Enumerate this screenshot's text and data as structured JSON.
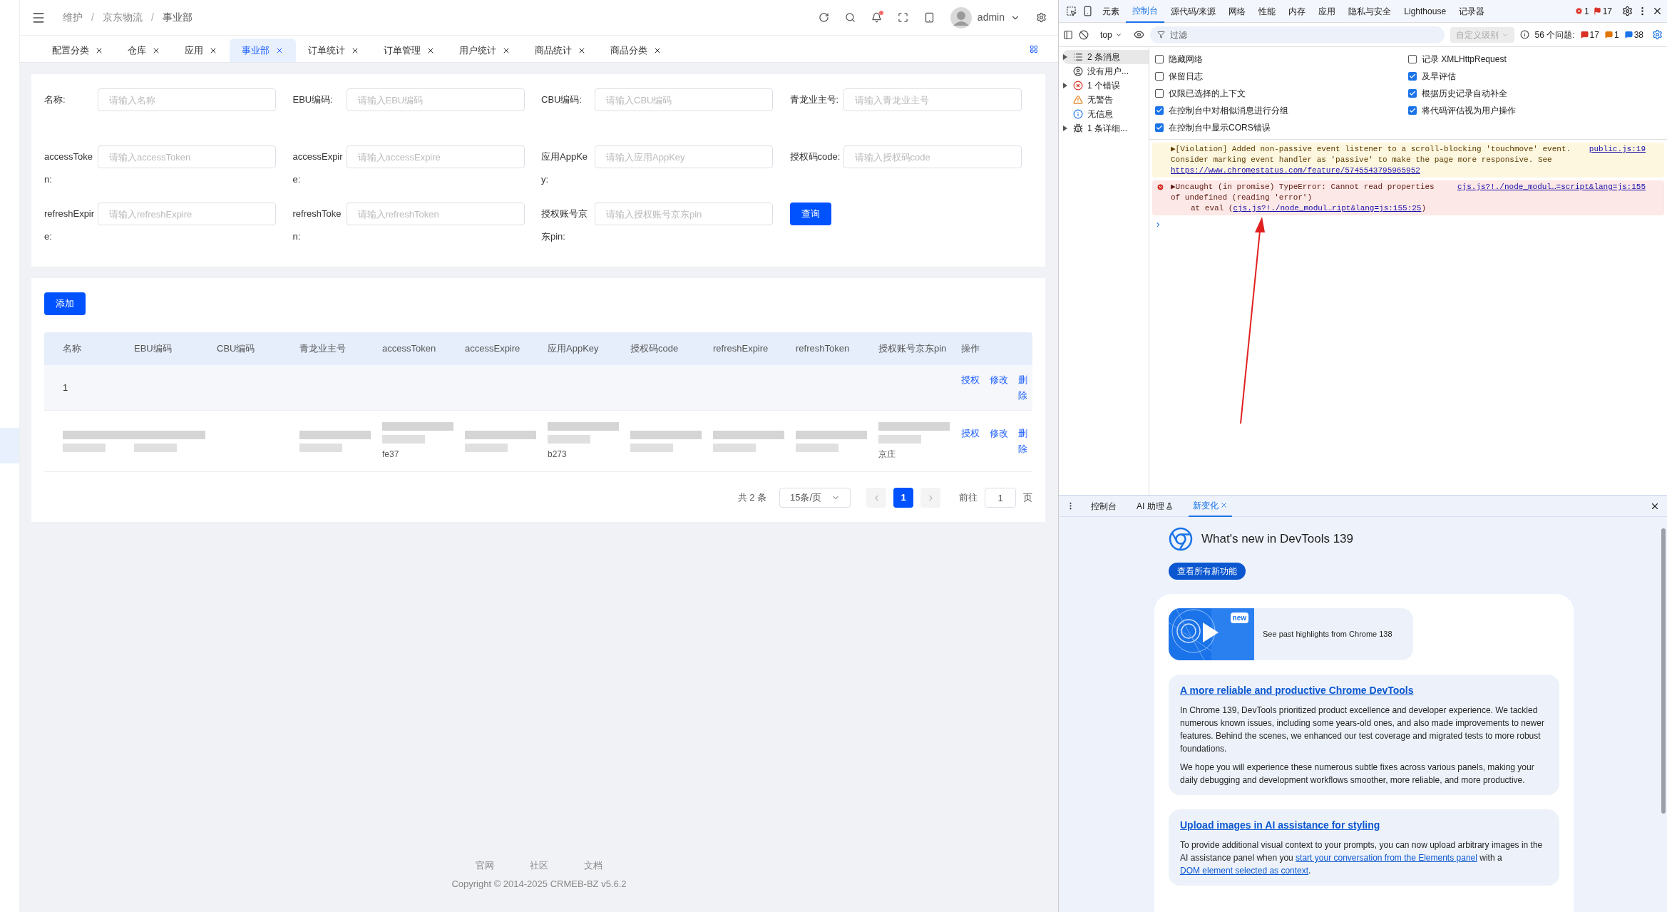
{
  "header": {
    "breadcrumb": [
      "维护",
      "京东物流",
      "事业部"
    ],
    "separator": "/",
    "user": "admin"
  },
  "tabs": [
    {
      "label": "配置分类",
      "selected": false
    },
    {
      "label": "仓库",
      "selected": false
    },
    {
      "label": "应用",
      "selected": false
    },
    {
      "label": "事业部",
      "selected": true
    },
    {
      "label": "订单统计",
      "selected": false
    },
    {
      "label": "订单管理",
      "selected": false
    },
    {
      "label": "用户统计",
      "selected": false
    },
    {
      "label": "商品统计",
      "selected": false
    },
    {
      "label": "商品分类",
      "selected": false
    }
  ],
  "filters": [
    {
      "label": "名称:",
      "placeholder": "请输入名称"
    },
    {
      "label": "EBU编码:",
      "placeholder": "请输入EBU编码"
    },
    {
      "label": "CBU编码:",
      "placeholder": "请输入CBU编码"
    },
    {
      "label": "青龙业主号:",
      "placeholder": "请输入青龙业主号"
    },
    {
      "label": "accessToken:",
      "placeholder": "请输入accessToken"
    },
    {
      "label": "accessExpire:",
      "placeholder": "请输入accessExpire"
    },
    {
      "label": "应用AppKey:",
      "placeholder": "请输入应用AppKey"
    },
    {
      "label": "授权码code:",
      "placeholder": "请输入授权码code"
    },
    {
      "label": "refreshExpire:",
      "placeholder": "请输入refreshExpire"
    },
    {
      "label": "refreshToken:",
      "placeholder": "请输入refreshToken"
    },
    {
      "label": "授权账号京东pin:",
      "placeholder": "请输入授权账号京东pin"
    }
  ],
  "query_button": "查询",
  "add_button": "添加",
  "table": {
    "columns": [
      "名称",
      "EBU编码",
      "CBU编码",
      "青龙业主号",
      "accessToken",
      "accessExpire",
      "应用AppKey",
      "授权码code",
      "refreshExpire",
      "refreshToken",
      "授权账号京东pin",
      "操作"
    ],
    "rows": [
      {
        "cells": [
          {
            "text": "1",
            "blurred": false
          },
          {
            "blurred": false
          },
          {
            "blurred": false
          },
          {
            "blurred": false
          },
          {
            "blurred": false
          },
          {
            "blurred": false
          },
          {
            "blurred": false
          },
          {
            "blurred": false
          },
          {
            "blurred": false
          },
          {
            "blurred": false
          },
          {
            "blurred": false
          }
        ],
        "actions": [
          "授权",
          "修改",
          "删除"
        ]
      },
      {
        "cells": [
          {
            "blurred": true
          },
          {
            "blurred": true
          },
          {
            "blurred": false
          },
          {
            "blurred": true
          },
          {
            "text": "fe37",
            "blurred": true
          },
          {
            "blurred": true
          },
          {
            "text": "b273",
            "blurred": true
          },
          {
            "blurred": true
          },
          {
            "blurred": true
          },
          {
            "blurred": true
          },
          {
            "text": "京庄",
            "blurred": true
          }
        ],
        "actions": [
          "授权",
          "修改",
          "删除"
        ]
      }
    ]
  },
  "pagination": {
    "total": "共 2 条",
    "page_size": "15条/页",
    "pages": [
      {
        "label": "1",
        "selected": true
      }
    ],
    "goto_label": "前往",
    "goto_value": "1",
    "page_unit": "页"
  },
  "footer": {
    "links": [
      "官网",
      "社区",
      "文档"
    ],
    "copyright": "Copyright © 2014-2025 CRMEB-BZ v5.6.2"
  },
  "devtools": {
    "tabs": [
      {
        "label": "元素",
        "selected": false
      },
      {
        "label": "控制台",
        "selected": true
      },
      {
        "label": "源代码/来源",
        "selected": false
      },
      {
        "label": "网络",
        "selected": false
      },
      {
        "label": "性能",
        "selected": false
      },
      {
        "label": "内存",
        "selected": false
      },
      {
        "label": "应用",
        "selected": false
      },
      {
        "label": "隐私与安全",
        "selected": false
      },
      {
        "label": "Lighthouse",
        "selected": false
      },
      {
        "label": "记录器",
        "selected": false
      }
    ],
    "error_count": "1",
    "issue_flag_count": "17",
    "context": "top",
    "filter_placeholder": "过滤",
    "level_dropdown": "自定义级别",
    "issues_label": "56 个问题:",
    "issue_counts": [
      {
        "kind": "error",
        "count": "17"
      },
      {
        "kind": "warning",
        "count": "1"
      },
      {
        "kind": "info",
        "count": "38"
      }
    ],
    "sidebar": [
      {
        "kind": "list",
        "label": "2 条消息",
        "selected": true,
        "expandable": true
      },
      {
        "kind": "user",
        "label": "没有用户...",
        "selected": false,
        "expandable": false
      },
      {
        "kind": "error",
        "label": "1 个错误",
        "selected": false,
        "expandable": true
      },
      {
        "kind": "warning",
        "label": "无警告",
        "selected": false,
        "expandable": false
      },
      {
        "kind": "info",
        "label": "无信息",
        "selected": false,
        "expandable": false
      },
      {
        "kind": "verbose",
        "label": "1 条详细...",
        "selected": false,
        "expandable": true
      }
    ],
    "settings": [
      [
        {
          "label": "隐藏网络",
          "checked": false
        },
        {
          "label": "保留日志",
          "checked": false
        },
        {
          "label": "仅限已选择的上下文",
          "checked": false
        },
        {
          "label": "在控制台中对相似消息进行分组",
          "checked": true
        },
        {
          "label": "在控制台中显示CORS错误",
          "checked": true
        }
      ],
      [
        {
          "label": "记录 XMLHttpRequest",
          "checked": false
        },
        {
          "label": "及早评估",
          "checked": true
        },
        {
          "label": "根据历史记录自动补全",
          "checked": true
        },
        {
          "label": "将代码评估视为用户操作",
          "checked": true
        }
      ]
    ],
    "messages": [
      {
        "kind": "warning",
        "text": "▶[Violation] Added non-passive event listener to a scroll-blocking 'touchmove' event. Consider marking event handler as 'passive' to make the page more responsive. See",
        "link": "https://www.chromestatus.com/feature/5745543795965952",
        "source": "public.js:19"
      },
      {
        "kind": "error",
        "text": "▶Uncaught (in promise) TypeError: Cannot read properties of undefined (reading 'error')",
        "trace_prefix": "at eval (",
        "trace_link": "cjs.js?!./node_modul…ript&lang=js:155:25",
        "trace_suffix": ")",
        "source": "cjs.js?!./node_modul…=script&lang=js:155"
      }
    ],
    "prompt": "›",
    "drawer_tabs": [
      {
        "label": "控制台",
        "selected": false,
        "closable": false
      },
      {
        "label": "AI 助理",
        "selected": false,
        "closable": false
      },
      {
        "label": "新变化",
        "selected": true,
        "closable": true
      }
    ],
    "whats_new": {
      "title": "What's new in DevTools 139",
      "button": "查看所有新功能",
      "video_badge": "new",
      "video_caption": "See past highlights from Chrome 138",
      "sections": [
        {
          "title": "A more reliable and productive Chrome DevTools",
          "paragraphs": [
            [
              {
                "text": "In Chrome 139, DevTools prioritized product excellence and developer experience. We tackled numerous known issues, including some years-old ones, and also made improvements to newer features. Behind the scenes, we enhanced our test coverage and migrated tests to more robust foundations."
              }
            ],
            [
              {
                "text": "We hope you will experience these numerous subtle fixes across various panels, making your daily debugging and development workflows smoother, more reliable, and more productive."
              }
            ]
          ]
        },
        {
          "title": "Upload images in AI assistance for styling",
          "paragraphs": [
            [
              {
                "text": "To provide additional visual context to your prompts, you can now upload arbitrary images in the AI assistance panel when you "
              },
              {
                "text": "start your conversation from the Elements panel",
                "link": true
              },
              {
                "text": " with a "
              },
              {
                "text": "DOM element selected as context",
                "link": true
              },
              {
                "text": "."
              }
            ]
          ]
        }
      ]
    }
  }
}
